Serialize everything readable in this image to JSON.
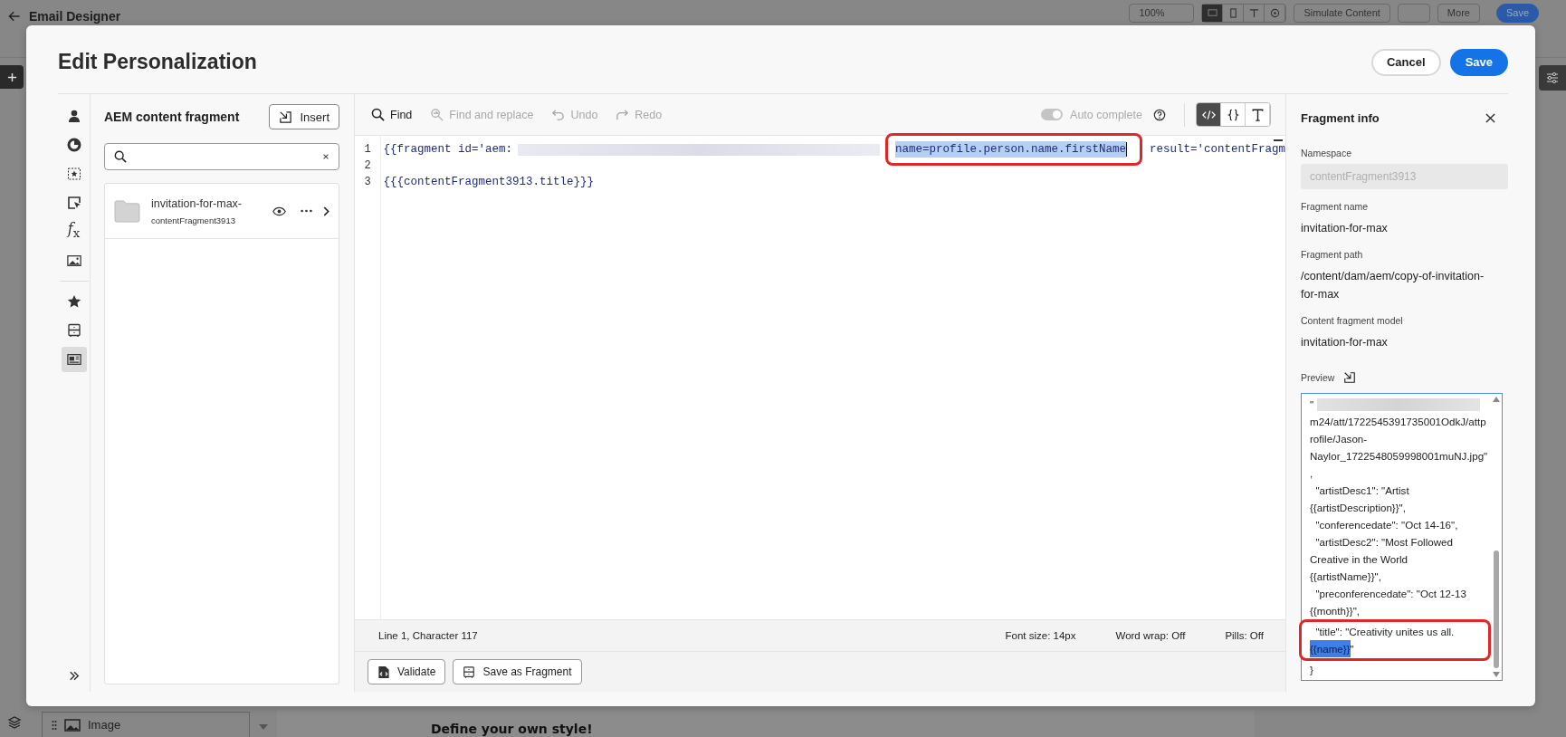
{
  "app": {
    "title": "Email Designer",
    "zoom": "100%",
    "view_modes": [
      {
        "kind": "desktop",
        "selected": true
      },
      {
        "kind": "mobile",
        "selected": false
      },
      {
        "kind": "text",
        "selected": false
      },
      {
        "kind": "preview",
        "selected": false
      }
    ],
    "simulate_button": "Simulate Content",
    "more_button": "More",
    "save_button": "Save",
    "layer_item": "Image",
    "canvas_heading": "Define your own style!"
  },
  "dialog": {
    "title": "Edit Personalization",
    "cancel_button": "Cancel",
    "save_button": "Save",
    "rail_groups": [
      {
        "items": [
          {
            "kind": "person",
            "selected": false
          },
          {
            "kind": "segment",
            "selected": false
          },
          {
            "kind": "offer",
            "selected": false
          },
          {
            "kind": "cursor",
            "selected": false
          },
          {
            "kind": "function",
            "label": "*f*$_{x}$",
            "selected": false
          },
          {
            "kind": "image",
            "selected": false
          }
        ]
      },
      {
        "items": [
          {
            "kind": "favorite",
            "selected": false
          },
          {
            "kind": "fragment",
            "selected": false
          },
          {
            "kind": "content",
            "selected": true
          }
        ]
      }
    ],
    "fragments": {
      "title": "AEM content fragment",
      "insert_button": "Insert",
      "items": [
        {
          "name": "invitation-for-max-",
          "id": "contentFragment3913"
        }
      ]
    },
    "editor": {
      "toolbar": [
        {
          "kind": "find",
          "label": "Find",
          "disabled": false
        },
        {
          "kind": "replace",
          "label": "Find and replace",
          "disabled": true
        },
        {
          "kind": "undo",
          "label": "Undo",
          "disabled": true
        },
        {
          "kind": "redo",
          "label": "Redo",
          "disabled": true
        }
      ],
      "autocomplete": {
        "label": "Auto complete",
        "on": true,
        "disabled": true
      },
      "modes": [
        {
          "kind": "code",
          "selected": true
        },
        {
          "kind": "braces",
          "selected": false
        },
        {
          "kind": "text",
          "selected": false
        }
      ],
      "lines": [
        {
          "number": "1",
          "segments": [
            {
              "kind": "text",
              "text": "{{fragment id='aem:"
            },
            {
              "kind": "redacted"
            },
            {
              "kind": "text",
              "text": "name=profile.person.name.firstName",
              "selected": true,
              "annotated": true
            },
            {
              "kind": "text",
              "text": " result='contentFragm"
            }
          ]
        },
        {
          "number": "2"
        },
        {
          "number": "3",
          "segments": [
            {
              "kind": "text",
              "text": "{{{contentFragment3913.title}}}"
            }
          ]
        }
      ],
      "status": {
        "position": "Line 1, Character 117",
        "settings": [
          "Font size: 14px",
          "Word wrap: Off",
          "Pills: Off"
        ]
      },
      "actions": [
        {
          "kind": "validate",
          "label": "Validate"
        },
        {
          "kind": "fragment",
          "label": "Save as Fragment"
        }
      ]
    },
    "info": {
      "title": "Fragment info",
      "namespace": {
        "label": "Namespace",
        "value": "contentFragment3913",
        "disabled": true
      },
      "fields": [
        {
          "label": "Fragment name",
          "value": "invitation-for-max"
        },
        {
          "label": "Fragment path",
          "value": "/content/dam/aem/copy-of-invitation-for-max"
        },
        {
          "label": "Content fragment model",
          "value": "invitation-for-max"
        }
      ],
      "preview_label": "Preview",
      "preview_lines": [
        {
          "segments": [
            {
              "kind": "text",
              "text": "\""
            },
            {
              "kind": "redacted"
            }
          ]
        },
        {
          "segments": [
            {
              "kind": "text",
              "text": "m24/att/1722545391735001OdkJ/attp"
            }
          ]
        },
        {
          "segments": [
            {
              "kind": "text",
              "text": "rofile/Jason-"
            }
          ]
        },
        {
          "segments": [
            {
              "kind": "text",
              "text": "Naylor_1722548059998001muNJ.jpg\""
            }
          ]
        },
        {
          "segments": [
            {
              "kind": "text",
              "text": ","
            }
          ]
        },
        {
          "segments": [
            {
              "kind": "text",
              "text": "  \"artistDesc1\": \"Artist"
            }
          ]
        },
        {
          "segments": [
            {
              "kind": "text",
              "text": "{{artistDescription}}\","
            }
          ]
        },
        {
          "segments": [
            {
              "kind": "text",
              "text": "  \"conferencedate\": \"Oct 14-16\","
            }
          ]
        },
        {
          "segments": [
            {
              "kind": "text",
              "text": "  \"artistDesc2\": \"Most Followed"
            }
          ]
        },
        {
          "segments": [
            {
              "kind": "text",
              "text": "Creative in the World"
            }
          ]
        },
        {
          "segments": [
            {
              "kind": "text",
              "text": "{{artistName}}\","
            }
          ]
        },
        {
          "segments": [
            {
              "kind": "text",
              "text": "  \"preconferencedate\": \"Oct 12-13"
            }
          ]
        },
        {
          "segments": [
            {
              "kind": "text",
              "text": "{{month}}\","
            }
          ]
        },
        {
          "segments": [
            {
              "kind": "text",
              "text": "  \"title\": \"Creativity unites us all."
            }
          ],
          "annotated": true
        },
        {
          "segments": [
            {
              "kind": "text",
              "text": "{{name}}",
              "selected": true
            },
            {
              "kind": "text",
              "text": "\""
            }
          ],
          "annotated": true
        },
        {
          "segments": [
            {
              "kind": "text",
              "text": "}"
            }
          ]
        }
      ]
    }
  }
}
